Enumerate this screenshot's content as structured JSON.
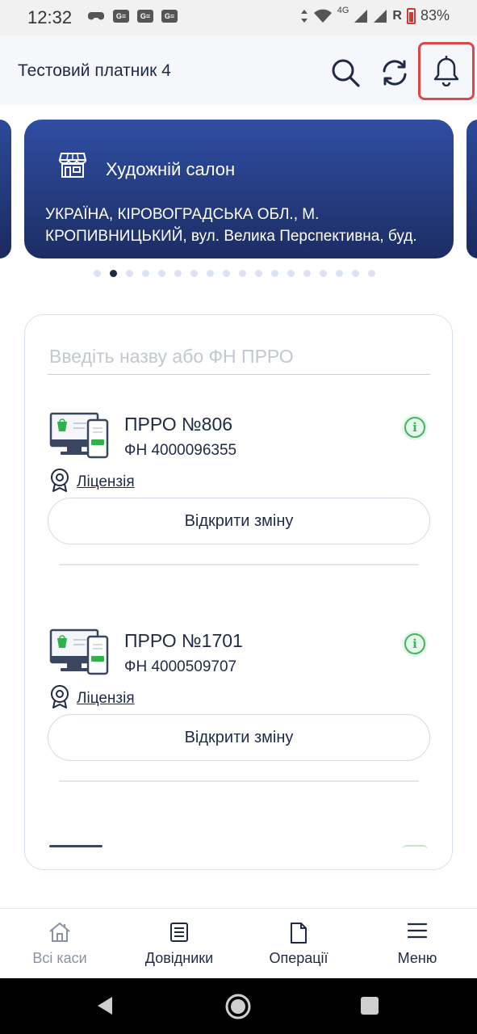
{
  "status_bar": {
    "time": "12:32",
    "network": "4G",
    "roaming": "R",
    "battery": "83%"
  },
  "header": {
    "title": "Тестовий платник 4",
    "icons": [
      "search-icon",
      "sync-icon",
      "bell-icon"
    ]
  },
  "carousel": {
    "store_name": "Художній салон",
    "address": "УКРАЇНА, КІРОВОГРАДСЬКА ОБЛ., М. КРОПИВНИЦЬКИЙ, вул. Велика Перспективна, буд.",
    "address_line1": "УКРАЇНА, КІРОВОГРАДСЬКА ОБЛ., М.",
    "address_line2": "КРОПИВНИЦЬКИЙ, вул. Велика Перспективна, буд.",
    "page_count": 18,
    "active_page": 2,
    "card_color_top": "#2f4ea3",
    "card_color_bottom": "#1c2d63"
  },
  "search": {
    "placeholder": "Введіть назву або ФН ПРРО",
    "value": ""
  },
  "prro_list": [
    {
      "name": "ПРРО №806",
      "fn": "ФН 4000096355",
      "license_label": "Ліцензія",
      "button_label": "Відкрити зміну"
    },
    {
      "name": "ПРРО №1701",
      "fn": "ФН 4000509707",
      "license_label": "Ліцензія",
      "button_label": "Відкрити зміну"
    }
  ],
  "bottom_nav": {
    "items": [
      {
        "label": "Всі каси",
        "icon": "home-icon",
        "active": false
      },
      {
        "label": "Довідники",
        "icon": "document-list-icon",
        "active": true
      },
      {
        "label": "Операції",
        "icon": "file-icon",
        "active": true
      },
      {
        "label": "Меню",
        "icon": "hamburger-icon",
        "active": true
      }
    ]
  },
  "colors": {
    "primary_text": "#1f2a44",
    "accent_green": "#3fb65a",
    "highlight_red": "#e0454c"
  }
}
